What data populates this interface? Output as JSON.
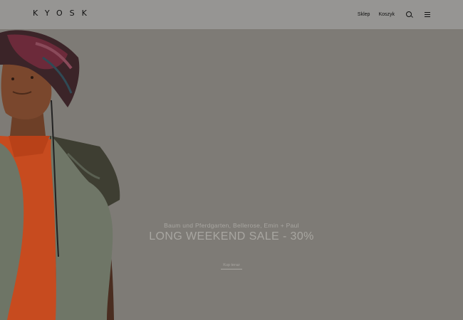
{
  "header": {
    "logo": "KYOSK",
    "nav": {
      "shop_label": "Sklep",
      "cart_label": "Koszyk"
    },
    "icons": {
      "search": "search-icon",
      "menu": "menu-icon"
    }
  },
  "hero": {
    "subtitle": "Baum und Pferdgarten, Bellerose, Emin + Paul",
    "headline": "LONG WEEKEND SALE - 30%",
    "cta_label": "Kup teraz"
  },
  "colors": {
    "header_bg": "#969593",
    "hero_bg": "#7e7b76",
    "caption_text": "#a8a6a1"
  }
}
